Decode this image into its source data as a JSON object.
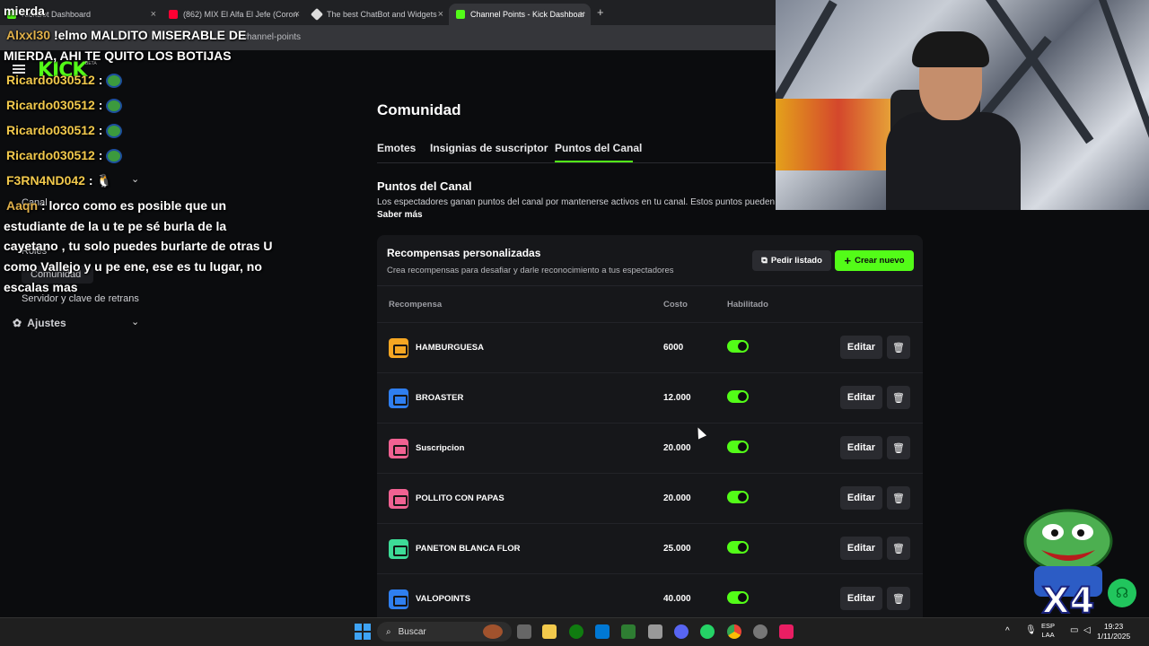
{
  "browser": {
    "tabs": [
      {
        "label": "KickBot Dashboard"
      },
      {
        "label": "(862) MIX El Alfa El Jefe (Coron"
      },
      {
        "label": "The best ChatBot and Widgets"
      },
      {
        "label": "Channel Points - Kick Dashboar"
      }
    ],
    "url": "channel-points"
  },
  "sidebar": {
    "items": [
      {
        "label": "Canal"
      },
      {
        "label": "Roles"
      },
      {
        "label": "Comunidad"
      },
      {
        "label": "Servidor y clave de retrans"
      },
      {
        "label": "Ajustes"
      }
    ]
  },
  "chat": [
    {
      "user": "mierda",
      "message": ""
    },
    {
      "user": "Alxxl30",
      "message": "!elmo MALDITO MISERABLE DE"
    },
    {
      "user": "",
      "message": "MIERDA, AHI TE QUITO LOS BOTIJAS"
    },
    {
      "user": "Ricardo030512",
      "message": ":"
    },
    {
      "user": "Ricardo030512",
      "message": ":"
    },
    {
      "user": "Ricardo030512",
      "message": ":"
    },
    {
      "user": "Ricardo030512",
      "message": ":"
    },
    {
      "user": "F3RN4ND042",
      "message": ":"
    },
    {
      "user": "Aaqn",
      "message": ": lorco como es posible que un"
    },
    {
      "user": "",
      "message": "estudiante de la u te pe sé burla de la"
    },
    {
      "user": "",
      "message": "cayetano , tu solo puedes burlarte de otras U"
    },
    {
      "user": "",
      "message": "como Vallejo y u pe ene, ese es tu lugar, no"
    },
    {
      "user": "",
      "message": "escalas mas"
    }
  ],
  "main": {
    "title": "Comunidad",
    "tabs": [
      {
        "label": "Emotes"
      },
      {
        "label": "Insignias de suscriptor"
      },
      {
        "label": "Puntos del Canal"
      }
    ],
    "section_title": "Puntos del Canal",
    "section_desc": "Los espectadores ganan puntos del canal por mantenerse activos en tu canal. Estos puntos pueden",
    "learn_more": "Saber más",
    "card": {
      "title": "Recompensas personalizadas",
      "subtitle": "Crea recompensas para desafiar y darle reconocimiento a tus espectadores",
      "request_list_label": "Pedir listado",
      "create_label": "Crear nuevo",
      "columns": [
        "Recompensa",
        "Costo",
        "Habilitado"
      ],
      "rows": [
        {
          "name": "HAMBURGUESA",
          "cost": "6000",
          "color": "#f5a623",
          "enabled": true,
          "edit": "Editar"
        },
        {
          "name": "BROASTER",
          "cost": "12.000",
          "color": "#2f7ff0",
          "enabled": true,
          "edit": "Editar"
        },
        {
          "name": "Suscripcion",
          "cost": "20.000",
          "color": "#f06292",
          "enabled": true,
          "edit": "Editar"
        },
        {
          "name": "POLLITO CON PAPAS",
          "cost": "20.000",
          "color": "#f06292",
          "enabled": true,
          "edit": "Editar"
        },
        {
          "name": "PANETON BLANCA FLOR",
          "cost": "25.000",
          "color": "#3ddc97",
          "enabled": true,
          "edit": "Editar"
        },
        {
          "name": "VALOPOINTS",
          "cost": "40.000",
          "color": "#2f7ff0",
          "enabled": true,
          "edit": "Editar"
        }
      ]
    }
  },
  "taskbar": {
    "search_label": "Buscar",
    "lang_top": "ESP",
    "lang_bottom": "LAA",
    "time": "19:23",
    "date": "1/11/2025"
  },
  "overlay": {
    "sticker_text": "X4"
  },
  "colors": {
    "accent": "#53fc18",
    "background": "#0b0c0e",
    "card": "#16171a"
  }
}
